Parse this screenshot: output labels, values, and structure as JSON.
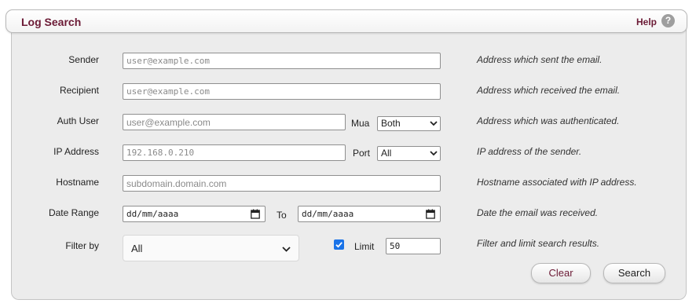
{
  "header": {
    "title": "Log Search",
    "help_label": "Help",
    "help_icon": "?"
  },
  "fields": {
    "sender": {
      "label": "Sender",
      "placeholder": "user@example.com",
      "description": "Address which sent the email."
    },
    "recipient": {
      "label": "Recipient",
      "placeholder": "user@example.com",
      "description": "Address which received the email."
    },
    "auth_user": {
      "label": "Auth User",
      "placeholder": "user@example.com",
      "description": "Address which was authenticated."
    },
    "mua": {
      "label": "Mua",
      "selected": "Both"
    },
    "ip_address": {
      "label": "IP Address",
      "placeholder": "192.168.0.210",
      "description": "IP address of the sender."
    },
    "port": {
      "label": "Port",
      "selected": "All"
    },
    "hostname": {
      "label": "Hostname",
      "placeholder": "subdomain.domain.com",
      "description": "Hostname associated with IP address."
    },
    "date_range": {
      "label": "Date Range",
      "from_placeholder": "dd/mm/aaaa",
      "to_label": "To",
      "to_placeholder": "dd/mm/aaaa",
      "description": "Date the email was received."
    },
    "filter_by": {
      "label": "Filter by",
      "selected": "All",
      "description": "Filter and limit search results."
    },
    "limit": {
      "label": "Limit",
      "value": "50",
      "checked": true
    }
  },
  "buttons": {
    "clear": "Clear",
    "search": "Search"
  },
  "colors": {
    "title": "#6b1a35",
    "checkbox": "#1a73e8"
  }
}
